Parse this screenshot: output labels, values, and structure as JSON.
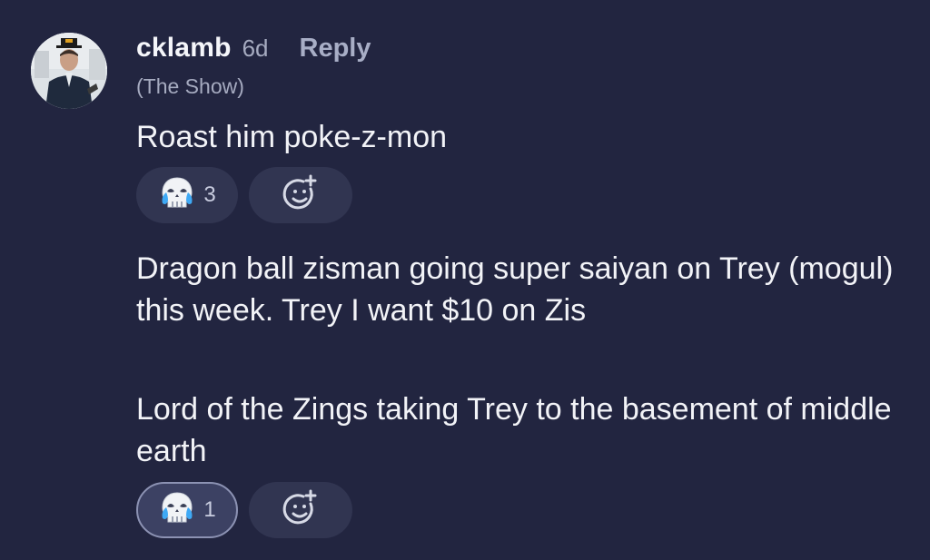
{
  "post": {
    "author": {
      "username": "cklamb",
      "time": "6d",
      "subtitle": "(The Show)",
      "avatar_icon": "user-avatar"
    },
    "reply_label": "Reply",
    "messages": [
      {
        "text": "Roast him poke-z-mon",
        "reactions": [
          {
            "icon": "skull-crying-laughing-icon",
            "count": "3",
            "active": false
          }
        ],
        "add_reaction_icon": "add-reaction-icon"
      },
      {
        "text": "Dragon ball zisman going super saiyan on Trey (mogul)  this week. Trey I want $10 on Zis"
      },
      {
        "text": "Lord of the Zings taking Trey to the basement of middle earth",
        "reactions": [
          {
            "icon": "skull-crying-laughing-icon",
            "count": "1",
            "active": true
          }
        ],
        "add_reaction_icon": "add-reaction-icon"
      }
    ]
  },
  "colors": {
    "background": "#222540",
    "pill": "#313551",
    "pill_active_border": "#8c92b3",
    "muted_text": "#a6abc0"
  }
}
